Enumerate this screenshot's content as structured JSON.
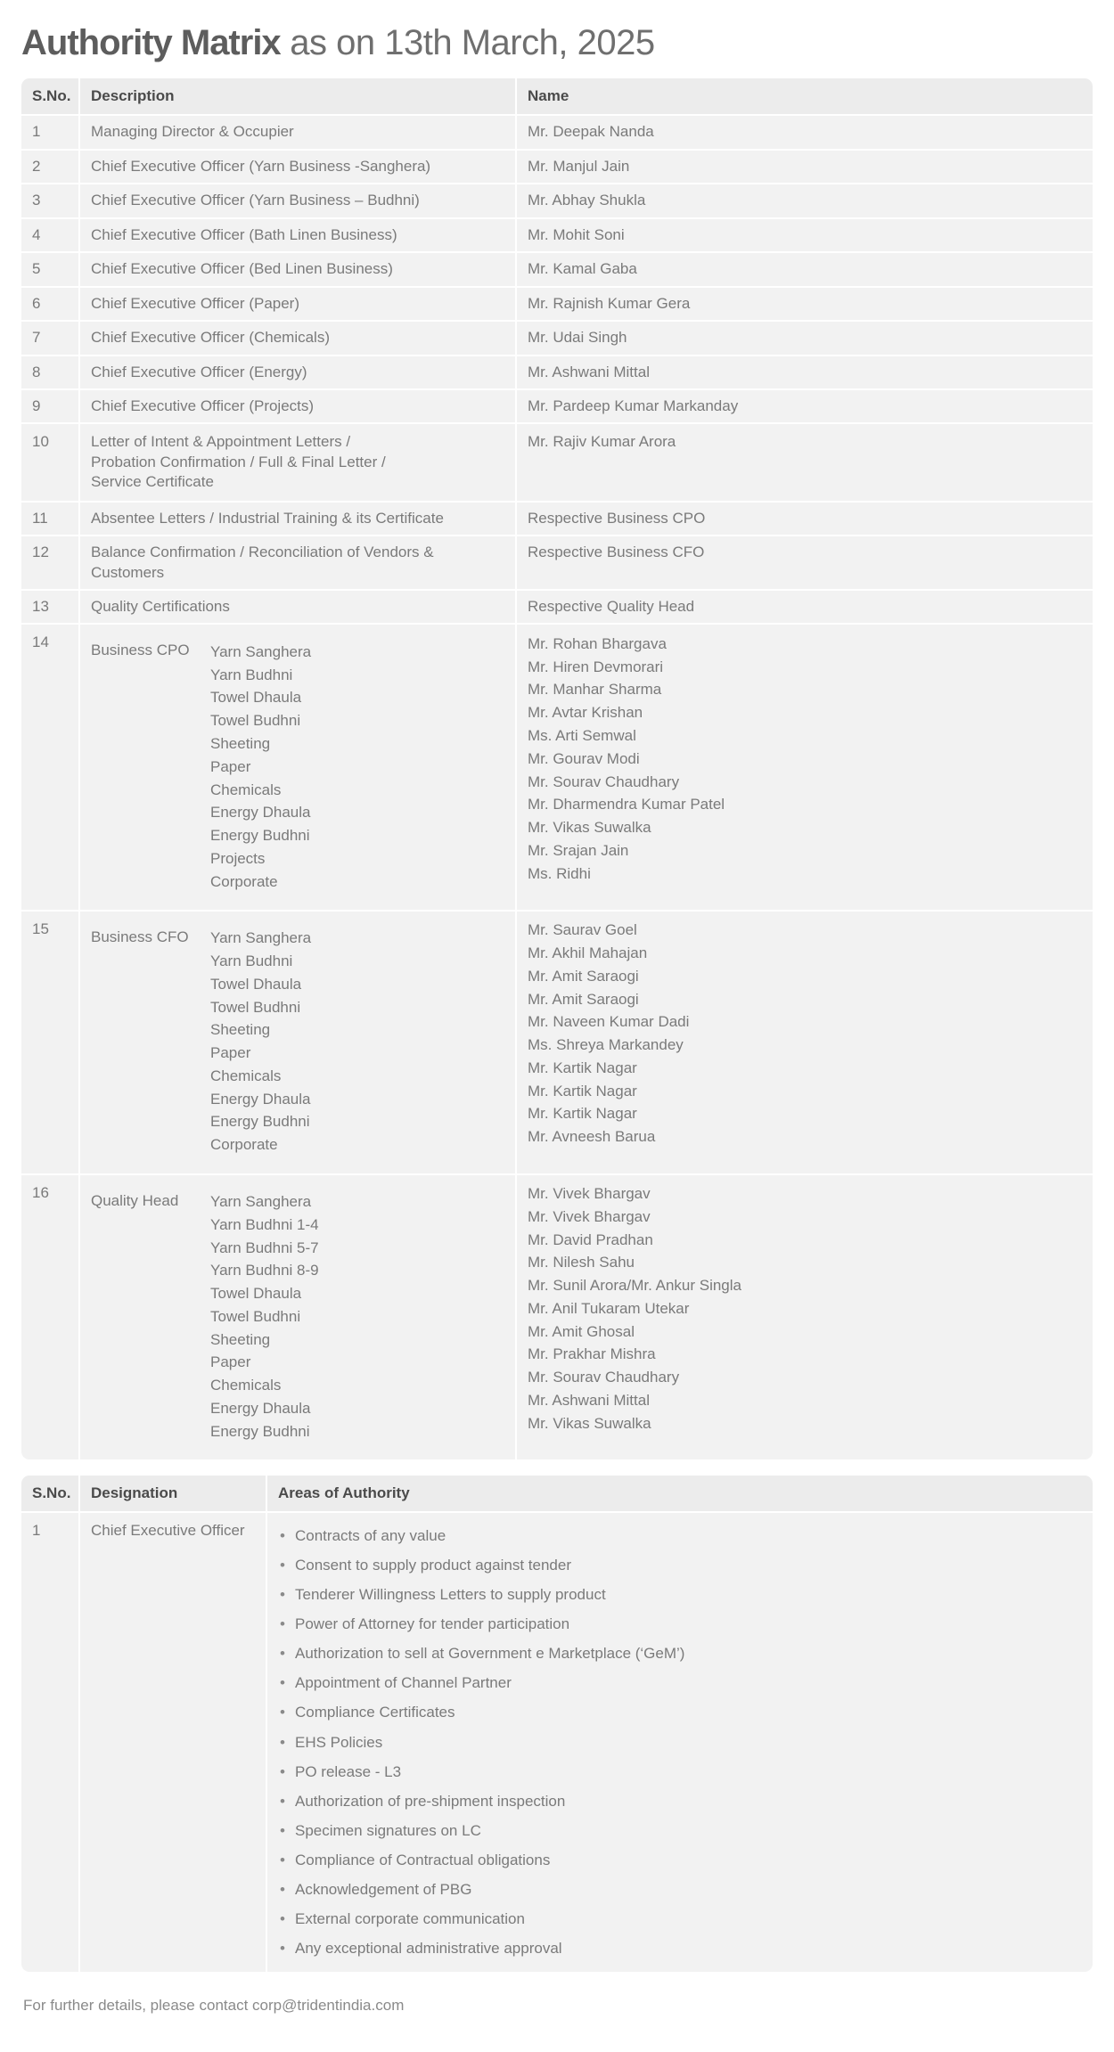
{
  "title": {
    "strong": "Authority Matrix",
    "light": " as on 13th March, 2025"
  },
  "table1": {
    "headers": {
      "sno": "S.No.",
      "description": "Description",
      "name": "Name"
    },
    "rows": [
      {
        "sno": "1",
        "description": "Managing Director & Occupier",
        "name": "Mr. Deepak Nanda"
      },
      {
        "sno": "2",
        "description": "Chief Executive Officer  (Yarn Business -Sanghera)",
        "name": "Mr. Manjul Jain"
      },
      {
        "sno": "3",
        "description": "Chief Executive Officer  (Yarn Business – Budhni)",
        "name": "Mr. Abhay Shukla"
      },
      {
        "sno": "4",
        "description": "Chief Executive Officer (Bath Linen Business)",
        "name": "Mr. Mohit Soni"
      },
      {
        "sno": "5",
        "description": "Chief Executive Officer (Bed Linen Business)",
        "name": "Mr. Kamal Gaba"
      },
      {
        "sno": "6",
        "description": "Chief Executive Officer (Paper)",
        "name": "Mr. Rajnish Kumar Gera"
      },
      {
        "sno": "7",
        "description": "Chief Executive Officer (Chemicals)",
        "name": "Mr. Udai Singh"
      },
      {
        "sno": "8",
        "description": "Chief Executive Officer (Energy)",
        "name": "Mr. Ashwani Mittal"
      },
      {
        "sno": "9",
        "description": "Chief Executive Officer (Projects)",
        "name": "Mr. Pardeep Kumar Markanday"
      },
      {
        "sno": "10",
        "description": "Letter of Intent & Appointment Letters /\nProbation Confirmation / Full & Final Letter /\nService Certificate",
        "name": "Mr. Rajiv Kumar Arora"
      },
      {
        "sno": "11",
        "description": "Absentee Letters / Industrial Training & its Certificate",
        "name": "Respective Business CPO"
      },
      {
        "sno": "12",
        "description": "Balance Confirmation / Reconciliation of Vendors & Customers",
        "name": "Respective Business CFO"
      },
      {
        "sno": "13",
        "description": "Quality Certifications",
        "name": "Respective Quality Head"
      }
    ],
    "groups": [
      {
        "sno": "14",
        "label": "Business CPO",
        "units": [
          "Yarn Sanghera",
          "Yarn Budhni",
          "Towel Dhaula",
          "Towel Budhni",
          "Sheeting",
          "Paper",
          "Chemicals",
          "Energy Dhaula",
          "Energy Budhni",
          "Projects",
          "Corporate"
        ],
        "names": [
          "Mr. Rohan Bhargava",
          "Mr. Hiren Devmorari",
          "Mr. Manhar Sharma",
          "Mr. Avtar Krishan",
          "Ms. Arti Semwal",
          "Mr. Gourav Modi",
          "Mr. Sourav Chaudhary",
          "Mr. Dharmendra Kumar Patel",
          "Mr. Vikas Suwalka",
          "Mr. Srajan Jain",
          "Ms. Ridhi"
        ]
      },
      {
        "sno": "15",
        "label": "Business CFO",
        "units": [
          "Yarn Sanghera",
          "Yarn Budhni",
          "Towel Dhaula",
          "Towel Budhni",
          "Sheeting",
          "Paper",
          "Chemicals",
          "Energy Dhaula",
          "Energy Budhni",
          "Corporate"
        ],
        "names": [
          "Mr. Saurav Goel",
          "Mr. Akhil Mahajan",
          "Mr. Amit Saraogi",
          "Mr. Amit Saraogi",
          "Mr. Naveen Kumar Dadi",
          "Ms. Shreya Markandey",
          "Mr. Kartik Nagar",
          "Mr. Kartik Nagar",
          "Mr. Kartik Nagar",
          "Mr. Avneesh Barua"
        ]
      },
      {
        "sno": "16",
        "label": "Quality Head",
        "units": [
          "Yarn Sanghera",
          "Yarn Budhni 1-4",
          "Yarn Budhni 5-7",
          "Yarn Budhni 8-9",
          "Towel Dhaula",
          "Towel Budhni",
          "Sheeting",
          "Paper",
          "Chemicals",
          "Energy Dhaula",
          "Energy Budhni"
        ],
        "names": [
          "Mr. Vivek Bhargav",
          "Mr. Vivek Bhargav",
          "Mr. David Pradhan",
          "Mr. Nilesh Sahu",
          "Mr. Sunil Arora/Mr. Ankur Singla",
          "Mr. Anil Tukaram Utekar",
          "Mr. Amit Ghosal",
          "Mr. Prakhar Mishra",
          "Mr. Sourav Chaudhary",
          "Mr. Ashwani Mittal",
          "Mr. Vikas Suwalka"
        ]
      }
    ]
  },
  "table2": {
    "headers": {
      "sno": "S.No.",
      "designation": "Designation",
      "areas": "Areas of Authority"
    },
    "rows": [
      {
        "sno": "1",
        "designation": "Chief Executive Officer",
        "areas": [
          "Contracts of any value",
          "Consent to supply product against tender",
          "Tenderer Willingness Letters to supply product",
          "Power of Attorney for tender participation",
          "Authorization to sell at Government e Marketplace (‘GeM’)",
          "Appointment of Channel Partner",
          "Compliance Certificates",
          "EHS Policies",
          "PO release - L3",
          "Authorization of pre-shipment inspection",
          "Specimen signatures on LC",
          "Compliance of Contractual obligations",
          "Acknowledgement of PBG",
          "External corporate communication",
          "Any exceptional administrative approval"
        ]
      }
    ]
  },
  "footer": {
    "note": "For further details, please contact corp@tridentindia.com"
  },
  "colors": {
    "cell_bg": "#f2f2f2",
    "header_bg": "#ececec",
    "text": "#7a7a7a",
    "header_text": "#4a4a4a",
    "title": "#5d5d5d"
  }
}
